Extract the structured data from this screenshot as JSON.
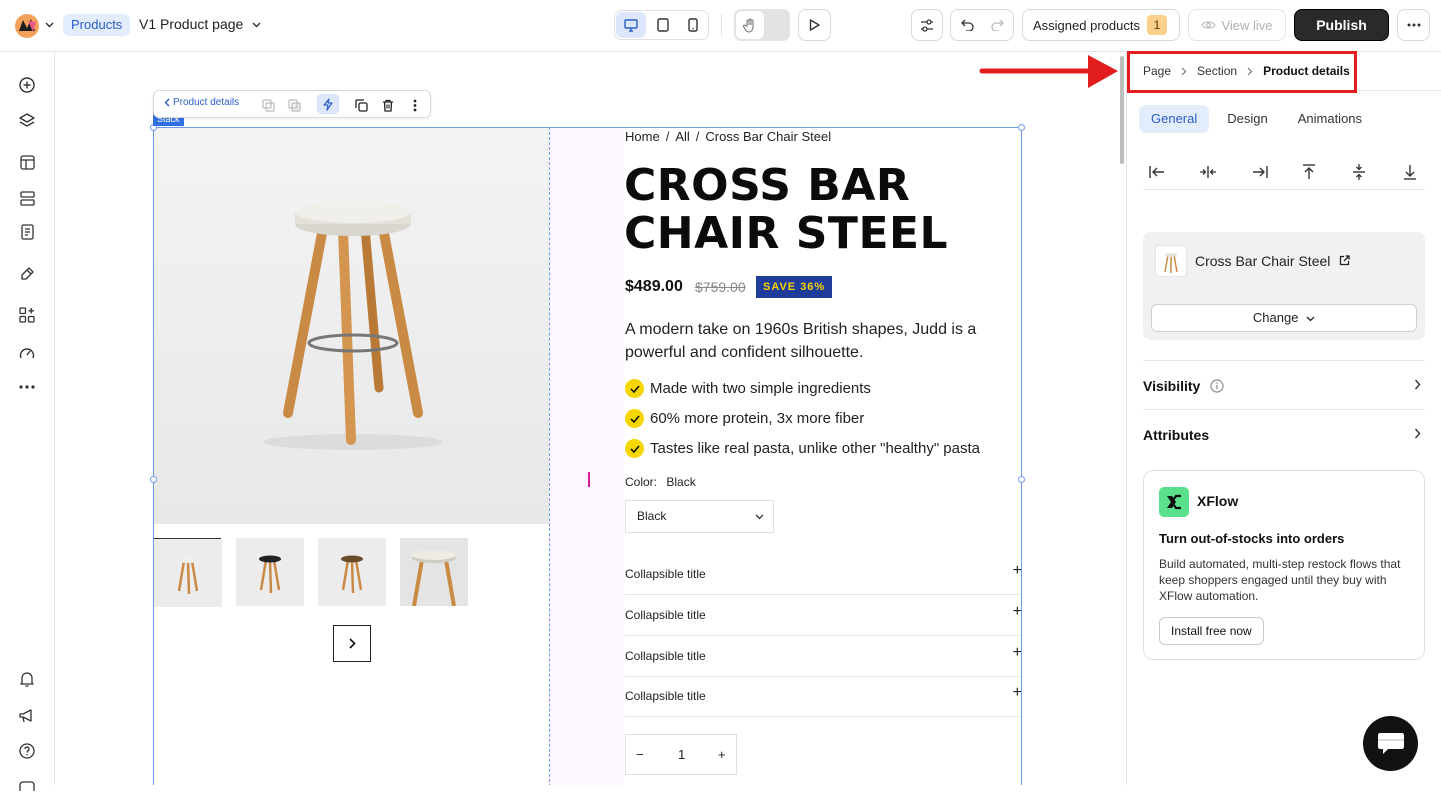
{
  "topbar": {
    "products_tag": "Products",
    "page_name": "V1 Product page",
    "assigned_label": "Assigned products",
    "assigned_count": "1",
    "view_live": "View live",
    "publish": "Publish"
  },
  "element_toolbar": {
    "back_label": "Product details",
    "stack_tag": "Stack"
  },
  "product": {
    "breadcrumb": [
      "Home",
      "All",
      "Cross Bar Chair Steel"
    ],
    "title": "Cross Bar Chair Steel",
    "price": "$489.00",
    "compare_price": "$759.00",
    "save_badge": "SAVE 36%",
    "description": "A modern take on 1960s British shapes, Judd is a powerful and confident silhouette.",
    "features": [
      "Made with two simple ingredients",
      "60% more protein, 3x more fiber",
      "Tastes like real pasta, unlike other \"healthy\" pasta"
    ],
    "color_label": "Color:",
    "color_value": "Black",
    "select_value": "Black",
    "collapsibles": [
      "Collapsible title",
      "Collapsible title",
      "Collapsible title",
      "Collapsible title"
    ],
    "quantity": "1",
    "qty_minus": "−",
    "qty_plus": "+"
  },
  "panel": {
    "breadcrumb": [
      "Page",
      "Section",
      "Product details"
    ],
    "tabs": [
      "General",
      "Design",
      "Animations"
    ],
    "product_name": "Cross Bar Chair Steel",
    "change_btn": "Change",
    "visibility": "Visibility",
    "attributes": "Attributes",
    "xflow": {
      "brand": "XFlow",
      "headline": "Turn out-of-stocks into orders",
      "description": "Build automated, multi-step restock flows that keep shoppers engaged until they buy with XFlow automation.",
      "install": "Install free now"
    }
  },
  "colors": {
    "accent": "#2b5fc7",
    "publish_bg": "#2a2a2a",
    "save_badge_bg": "#1f3c9b",
    "check_yellow": "#f6d600",
    "annotation_red": "#e11d1d"
  }
}
